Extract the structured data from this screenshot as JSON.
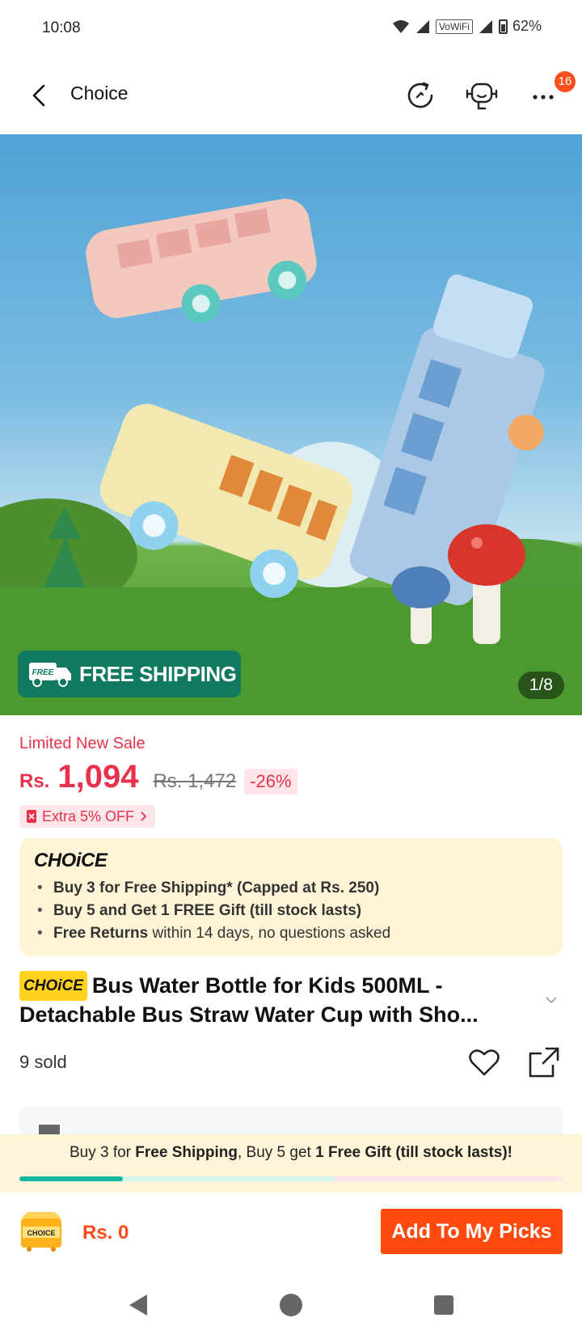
{
  "status": {
    "time": "10:08",
    "vowifi": "VoWiFi",
    "battery": "62%"
  },
  "header": {
    "title": "Choice",
    "badge_count": "16"
  },
  "hero": {
    "free_shipping_tag": "FREE",
    "free_shipping": "FREE SHIPPING",
    "pager": "1/8"
  },
  "pricing": {
    "promo_label": "Limited New Sale",
    "currency": "Rs.",
    "price": "1,094",
    "original_price": "Rs. 1,472",
    "discount": "-26%",
    "coupon": "Extra 5% OFF"
  },
  "choice_box": {
    "logo": "CHOiCE",
    "items": [
      {
        "bold": "Buy 3 for  Free Shipping* (Capped at Rs. 250)",
        "rest": ""
      },
      {
        "bold": "Buy 5 and Get 1 FREE Gift (till stock lasts)",
        "rest": ""
      },
      {
        "bold": "Free Returns",
        "rest": " within 14 days, no questions asked"
      }
    ]
  },
  "product": {
    "tag": "CHOiCE",
    "title": "Bus Water Bottle for Kids 500ML - Detachable Bus Straw Water Cup with Sho...",
    "sold": "9 sold"
  },
  "banner": {
    "part1": "Buy 3 for ",
    "part2": "Free Shipping",
    "part3": ", Buy 5 get ",
    "part4": "1 Free Gift (till stock lasts)!",
    "progress_fraction": 0.19
  },
  "action_bar": {
    "cart_label": "CHOICE",
    "total": "Rs. 0",
    "add_button": "Add To My Picks"
  },
  "colors": {
    "accent": "#ff4a0f",
    "price": "#e8324b",
    "shipping_green": "#0f7a5f"
  }
}
